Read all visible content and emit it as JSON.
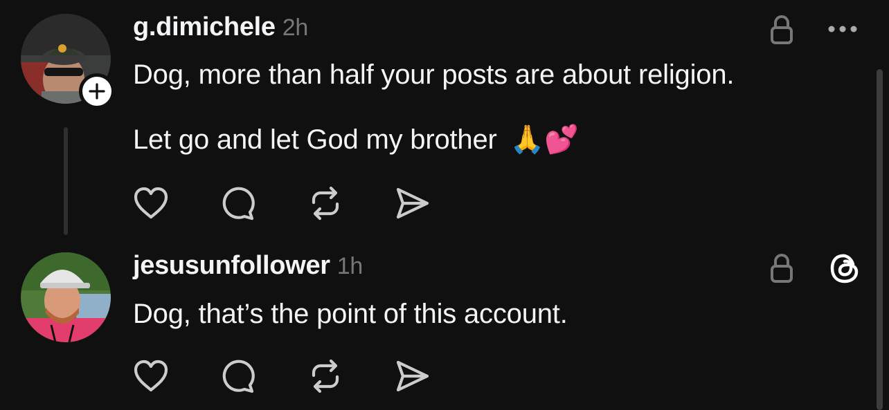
{
  "posts": [
    {
      "username": "g.dimichele",
      "time": "2h",
      "lines": [
        "Dog, more than half your posts are about religion.",
        "Let go and let God my brother"
      ],
      "emojis": [
        "🙏",
        "💕"
      ]
    },
    {
      "username": "jesusunfollower",
      "time": "1h",
      "lines": [
        "Dog, that’s the point of this account."
      ]
    }
  ],
  "icons": {
    "follow": "plus-icon",
    "lock": "lock-icon",
    "more": "more-icon",
    "threads": "threads-logo-icon",
    "like": "heart-icon",
    "reply": "comment-icon",
    "repost": "repost-icon",
    "share": "send-icon"
  },
  "colors": {
    "background": "#101010",
    "text": "#f3f5f7",
    "secondary": "#777777",
    "icon": "#cccccc"
  }
}
